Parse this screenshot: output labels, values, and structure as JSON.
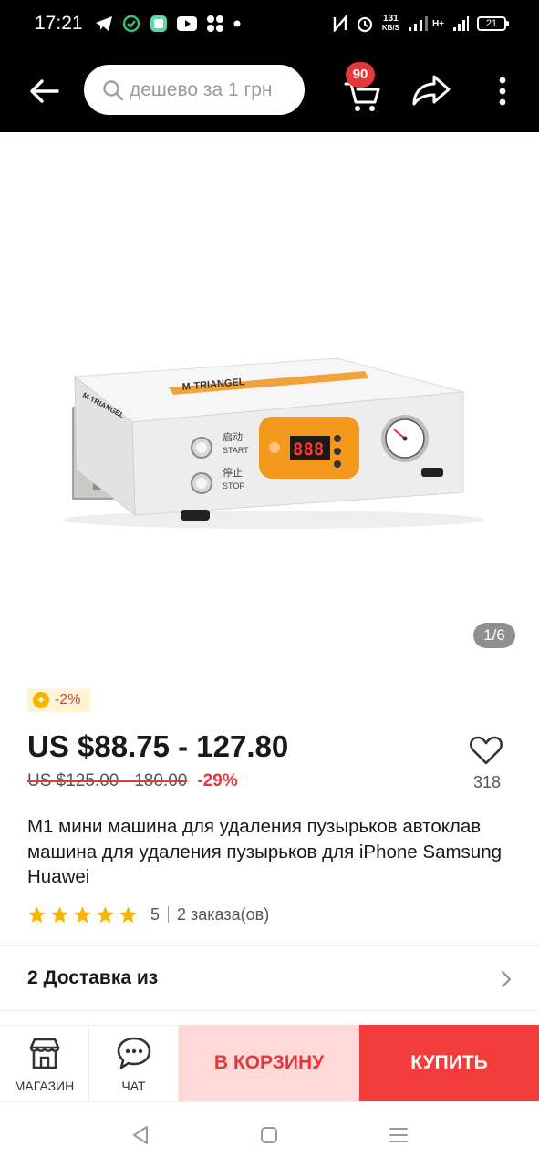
{
  "status_bar": {
    "time": "17:21",
    "net_speed_value": "131",
    "net_speed_unit": "KB/S",
    "network_type": "H+",
    "battery": "21"
  },
  "nav": {
    "search_placeholder": "дешево за 1 грн",
    "cart_badge": "90"
  },
  "gallery": {
    "counter": "1/6",
    "device_brand": "M-TRIANGEL",
    "start_cn": "启动",
    "start_en": "START",
    "stop_cn": "停止",
    "stop_en": "STOP",
    "display_readout": "888"
  },
  "product": {
    "coin_discount": "-2%",
    "price": "US $88.75 - 127.80",
    "old_price": "US $125.00 - 180.00",
    "discount": "-29%",
    "wishlist_count": "318",
    "title": "M1 мини машина для удаления пузырьков автоклав машина для удаления пузырьков для iPhone Samsung Huawei",
    "rating": "5",
    "orders": "2 заказа(ов)",
    "stars": 5
  },
  "delivery": {
    "label": "2 Доставка из"
  },
  "action_bar": {
    "store_label": "МАГАЗИН",
    "chat_label": "ЧАТ",
    "add_to_cart": "В КОРЗИНУ",
    "buy": "КУПИТЬ"
  },
  "colors": {
    "accent_red": "#e4393c",
    "buy_button": "#f33d3d",
    "cart_button_bg": "#ffd8d8",
    "coin_badge_bg": "#fff4d6",
    "star": "#f7b500"
  }
}
